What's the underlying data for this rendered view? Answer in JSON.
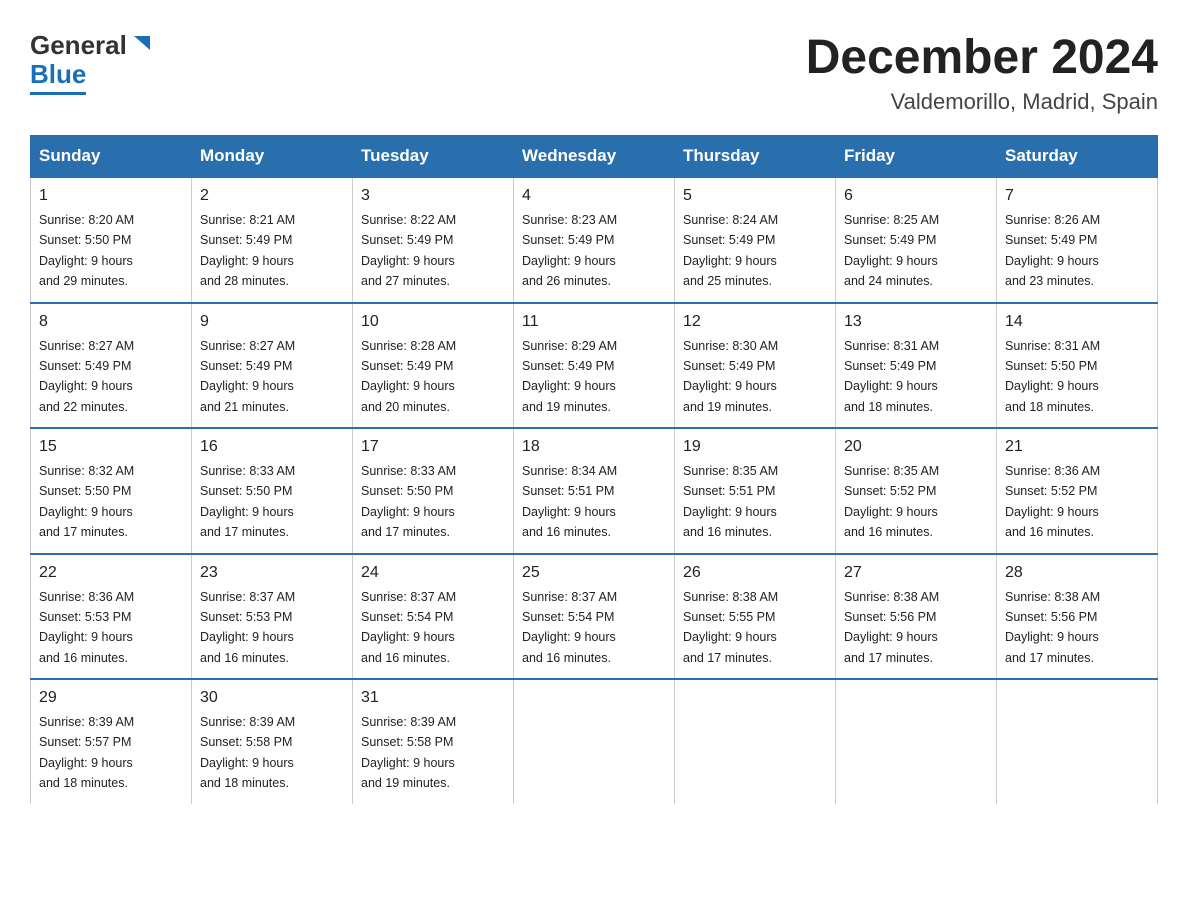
{
  "header": {
    "logo_general": "General",
    "logo_blue": "Blue",
    "month_title": "December 2024",
    "location": "Valdemorillo, Madrid, Spain"
  },
  "days_of_week": [
    "Sunday",
    "Monday",
    "Tuesday",
    "Wednesday",
    "Thursday",
    "Friday",
    "Saturday"
  ],
  "weeks": [
    {
      "days": [
        {
          "date": "1",
          "sunrise": "8:20 AM",
          "sunset": "5:50 PM",
          "daylight": "9 hours and 29 minutes."
        },
        {
          "date": "2",
          "sunrise": "8:21 AM",
          "sunset": "5:49 PM",
          "daylight": "9 hours and 28 minutes."
        },
        {
          "date": "3",
          "sunrise": "8:22 AM",
          "sunset": "5:49 PM",
          "daylight": "9 hours and 27 minutes."
        },
        {
          "date": "4",
          "sunrise": "8:23 AM",
          "sunset": "5:49 PM",
          "daylight": "9 hours and 26 minutes."
        },
        {
          "date": "5",
          "sunrise": "8:24 AM",
          "sunset": "5:49 PM",
          "daylight": "9 hours and 25 minutes."
        },
        {
          "date": "6",
          "sunrise": "8:25 AM",
          "sunset": "5:49 PM",
          "daylight": "9 hours and 24 minutes."
        },
        {
          "date": "7",
          "sunrise": "8:26 AM",
          "sunset": "5:49 PM",
          "daylight": "9 hours and 23 minutes."
        }
      ]
    },
    {
      "days": [
        {
          "date": "8",
          "sunrise": "8:27 AM",
          "sunset": "5:49 PM",
          "daylight": "9 hours and 22 minutes."
        },
        {
          "date": "9",
          "sunrise": "8:27 AM",
          "sunset": "5:49 PM",
          "daylight": "9 hours and 21 minutes."
        },
        {
          "date": "10",
          "sunrise": "8:28 AM",
          "sunset": "5:49 PM",
          "daylight": "9 hours and 20 minutes."
        },
        {
          "date": "11",
          "sunrise": "8:29 AM",
          "sunset": "5:49 PM",
          "daylight": "9 hours and 19 minutes."
        },
        {
          "date": "12",
          "sunrise": "8:30 AM",
          "sunset": "5:49 PM",
          "daylight": "9 hours and 19 minutes."
        },
        {
          "date": "13",
          "sunrise": "8:31 AM",
          "sunset": "5:49 PM",
          "daylight": "9 hours and 18 minutes."
        },
        {
          "date": "14",
          "sunrise": "8:31 AM",
          "sunset": "5:50 PM",
          "daylight": "9 hours and 18 minutes."
        }
      ]
    },
    {
      "days": [
        {
          "date": "15",
          "sunrise": "8:32 AM",
          "sunset": "5:50 PM",
          "daylight": "9 hours and 17 minutes."
        },
        {
          "date": "16",
          "sunrise": "8:33 AM",
          "sunset": "5:50 PM",
          "daylight": "9 hours and 17 minutes."
        },
        {
          "date": "17",
          "sunrise": "8:33 AM",
          "sunset": "5:50 PM",
          "daylight": "9 hours and 17 minutes."
        },
        {
          "date": "18",
          "sunrise": "8:34 AM",
          "sunset": "5:51 PM",
          "daylight": "9 hours and 16 minutes."
        },
        {
          "date": "19",
          "sunrise": "8:35 AM",
          "sunset": "5:51 PM",
          "daylight": "9 hours and 16 minutes."
        },
        {
          "date": "20",
          "sunrise": "8:35 AM",
          "sunset": "5:52 PM",
          "daylight": "9 hours and 16 minutes."
        },
        {
          "date": "21",
          "sunrise": "8:36 AM",
          "sunset": "5:52 PM",
          "daylight": "9 hours and 16 minutes."
        }
      ]
    },
    {
      "days": [
        {
          "date": "22",
          "sunrise": "8:36 AM",
          "sunset": "5:53 PM",
          "daylight": "9 hours and 16 minutes."
        },
        {
          "date": "23",
          "sunrise": "8:37 AM",
          "sunset": "5:53 PM",
          "daylight": "9 hours and 16 minutes."
        },
        {
          "date": "24",
          "sunrise": "8:37 AM",
          "sunset": "5:54 PM",
          "daylight": "9 hours and 16 minutes."
        },
        {
          "date": "25",
          "sunrise": "8:37 AM",
          "sunset": "5:54 PM",
          "daylight": "9 hours and 16 minutes."
        },
        {
          "date": "26",
          "sunrise": "8:38 AM",
          "sunset": "5:55 PM",
          "daylight": "9 hours and 17 minutes."
        },
        {
          "date": "27",
          "sunrise": "8:38 AM",
          "sunset": "5:56 PM",
          "daylight": "9 hours and 17 minutes."
        },
        {
          "date": "28",
          "sunrise": "8:38 AM",
          "sunset": "5:56 PM",
          "daylight": "9 hours and 17 minutes."
        }
      ]
    },
    {
      "days": [
        {
          "date": "29",
          "sunrise": "8:39 AM",
          "sunset": "5:57 PM",
          "daylight": "9 hours and 18 minutes."
        },
        {
          "date": "30",
          "sunrise": "8:39 AM",
          "sunset": "5:58 PM",
          "daylight": "9 hours and 18 minutes."
        },
        {
          "date": "31",
          "sunrise": "8:39 AM",
          "sunset": "5:58 PM",
          "daylight": "9 hours and 19 minutes."
        },
        null,
        null,
        null,
        null
      ]
    }
  ],
  "labels": {
    "sunrise": "Sunrise:",
    "sunset": "Sunset:",
    "daylight": "Daylight:"
  }
}
